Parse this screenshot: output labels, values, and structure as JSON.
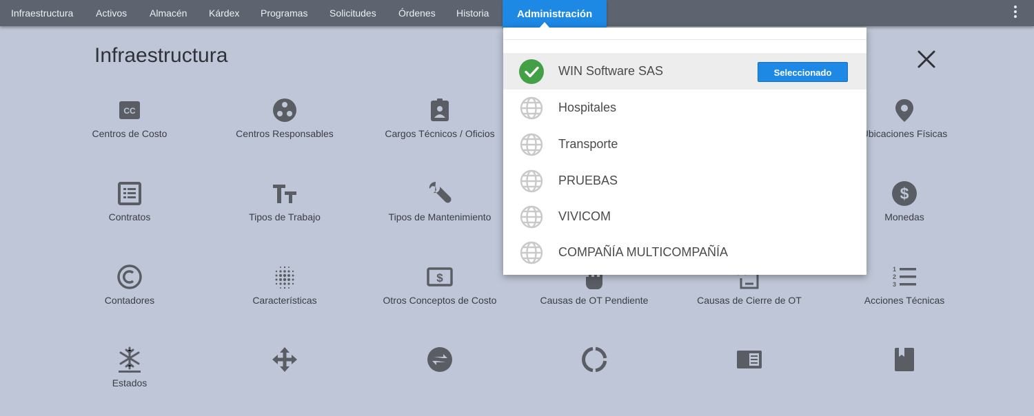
{
  "nav": {
    "items": [
      "Infraestructura",
      "Activos",
      "Almacén",
      "Kárdex",
      "Programas",
      "Solicitudes",
      "Órdenes",
      "Historia"
    ],
    "active": "Administración",
    "menu_icon": "more-vert-icon"
  },
  "page": {
    "title": "Infraestructura",
    "close_icon": "close-icon"
  },
  "tiles": [
    {
      "label": "Centros de Costo",
      "icon": "cc-icon"
    },
    {
      "label": "Centros Responsables",
      "icon": "group-work-icon"
    },
    {
      "label": "Cargos Técnicos / Oficios",
      "icon": "badge-icon"
    },
    {
      "label": "",
      "icon": "hidden"
    },
    {
      "label": "",
      "icon": "hidden"
    },
    {
      "label": "Ubicaciones Físicas",
      "icon": "location-pin-icon"
    },
    {
      "label": "Contratos",
      "icon": "list-document-icon"
    },
    {
      "label": "Tipos de Trabajo",
      "icon": "text-size-icon"
    },
    {
      "label": "Tipos de Mantenimiento",
      "icon": "wrench-icon"
    },
    {
      "label": "",
      "icon": "hidden"
    },
    {
      "label": "",
      "icon": "hidden"
    },
    {
      "label": "Monedas",
      "icon": "dollar-circle-icon"
    },
    {
      "label": "Contadores",
      "icon": "copyright-icon"
    },
    {
      "label": "Características",
      "icon": "blur-dots-icon"
    },
    {
      "label": "Otros Conceptos de Costo",
      "icon": "money-icon"
    },
    {
      "label": "Causas de OT Pendiente",
      "icon": "hand-icon"
    },
    {
      "label": "Causas de Cierre de OT",
      "icon": "close-document-icon"
    },
    {
      "label": "Acciones Técnicas",
      "icon": "numbered-list-icon"
    },
    {
      "label": "Estados",
      "icon": "snowflake-icon"
    },
    {
      "label": "",
      "icon": "move-arrows-icon"
    },
    {
      "label": "",
      "icon": "swap-circle-icon"
    },
    {
      "label": "",
      "icon": "ring-icon"
    },
    {
      "label": "",
      "icon": "reader-icon"
    },
    {
      "label": "",
      "icon": "bookmark-book-icon"
    }
  ],
  "dropdown": {
    "companies": [
      {
        "name": "WIN Software SAS",
        "selected": true,
        "badge": "Seleccionado",
        "icon": "check-circle-icon"
      },
      {
        "name": "Hospitales",
        "selected": false,
        "icon": "globe-icon"
      },
      {
        "name": "Transporte",
        "selected": false,
        "icon": "globe-icon"
      },
      {
        "name": "PRUEBAS",
        "selected": false,
        "icon": "globe-icon"
      },
      {
        "name": "VIVICOM",
        "selected": false,
        "icon": "globe-icon"
      },
      {
        "name": "COMPAÑÍA MULTICOMPAÑÍA",
        "selected": false,
        "icon": "globe-icon"
      }
    ]
  },
  "colors": {
    "topbar": "#5e646f",
    "accent": "#1e88e5",
    "background": "#bfc6d7",
    "success": "#43a047",
    "icon": "#5a5d63"
  }
}
